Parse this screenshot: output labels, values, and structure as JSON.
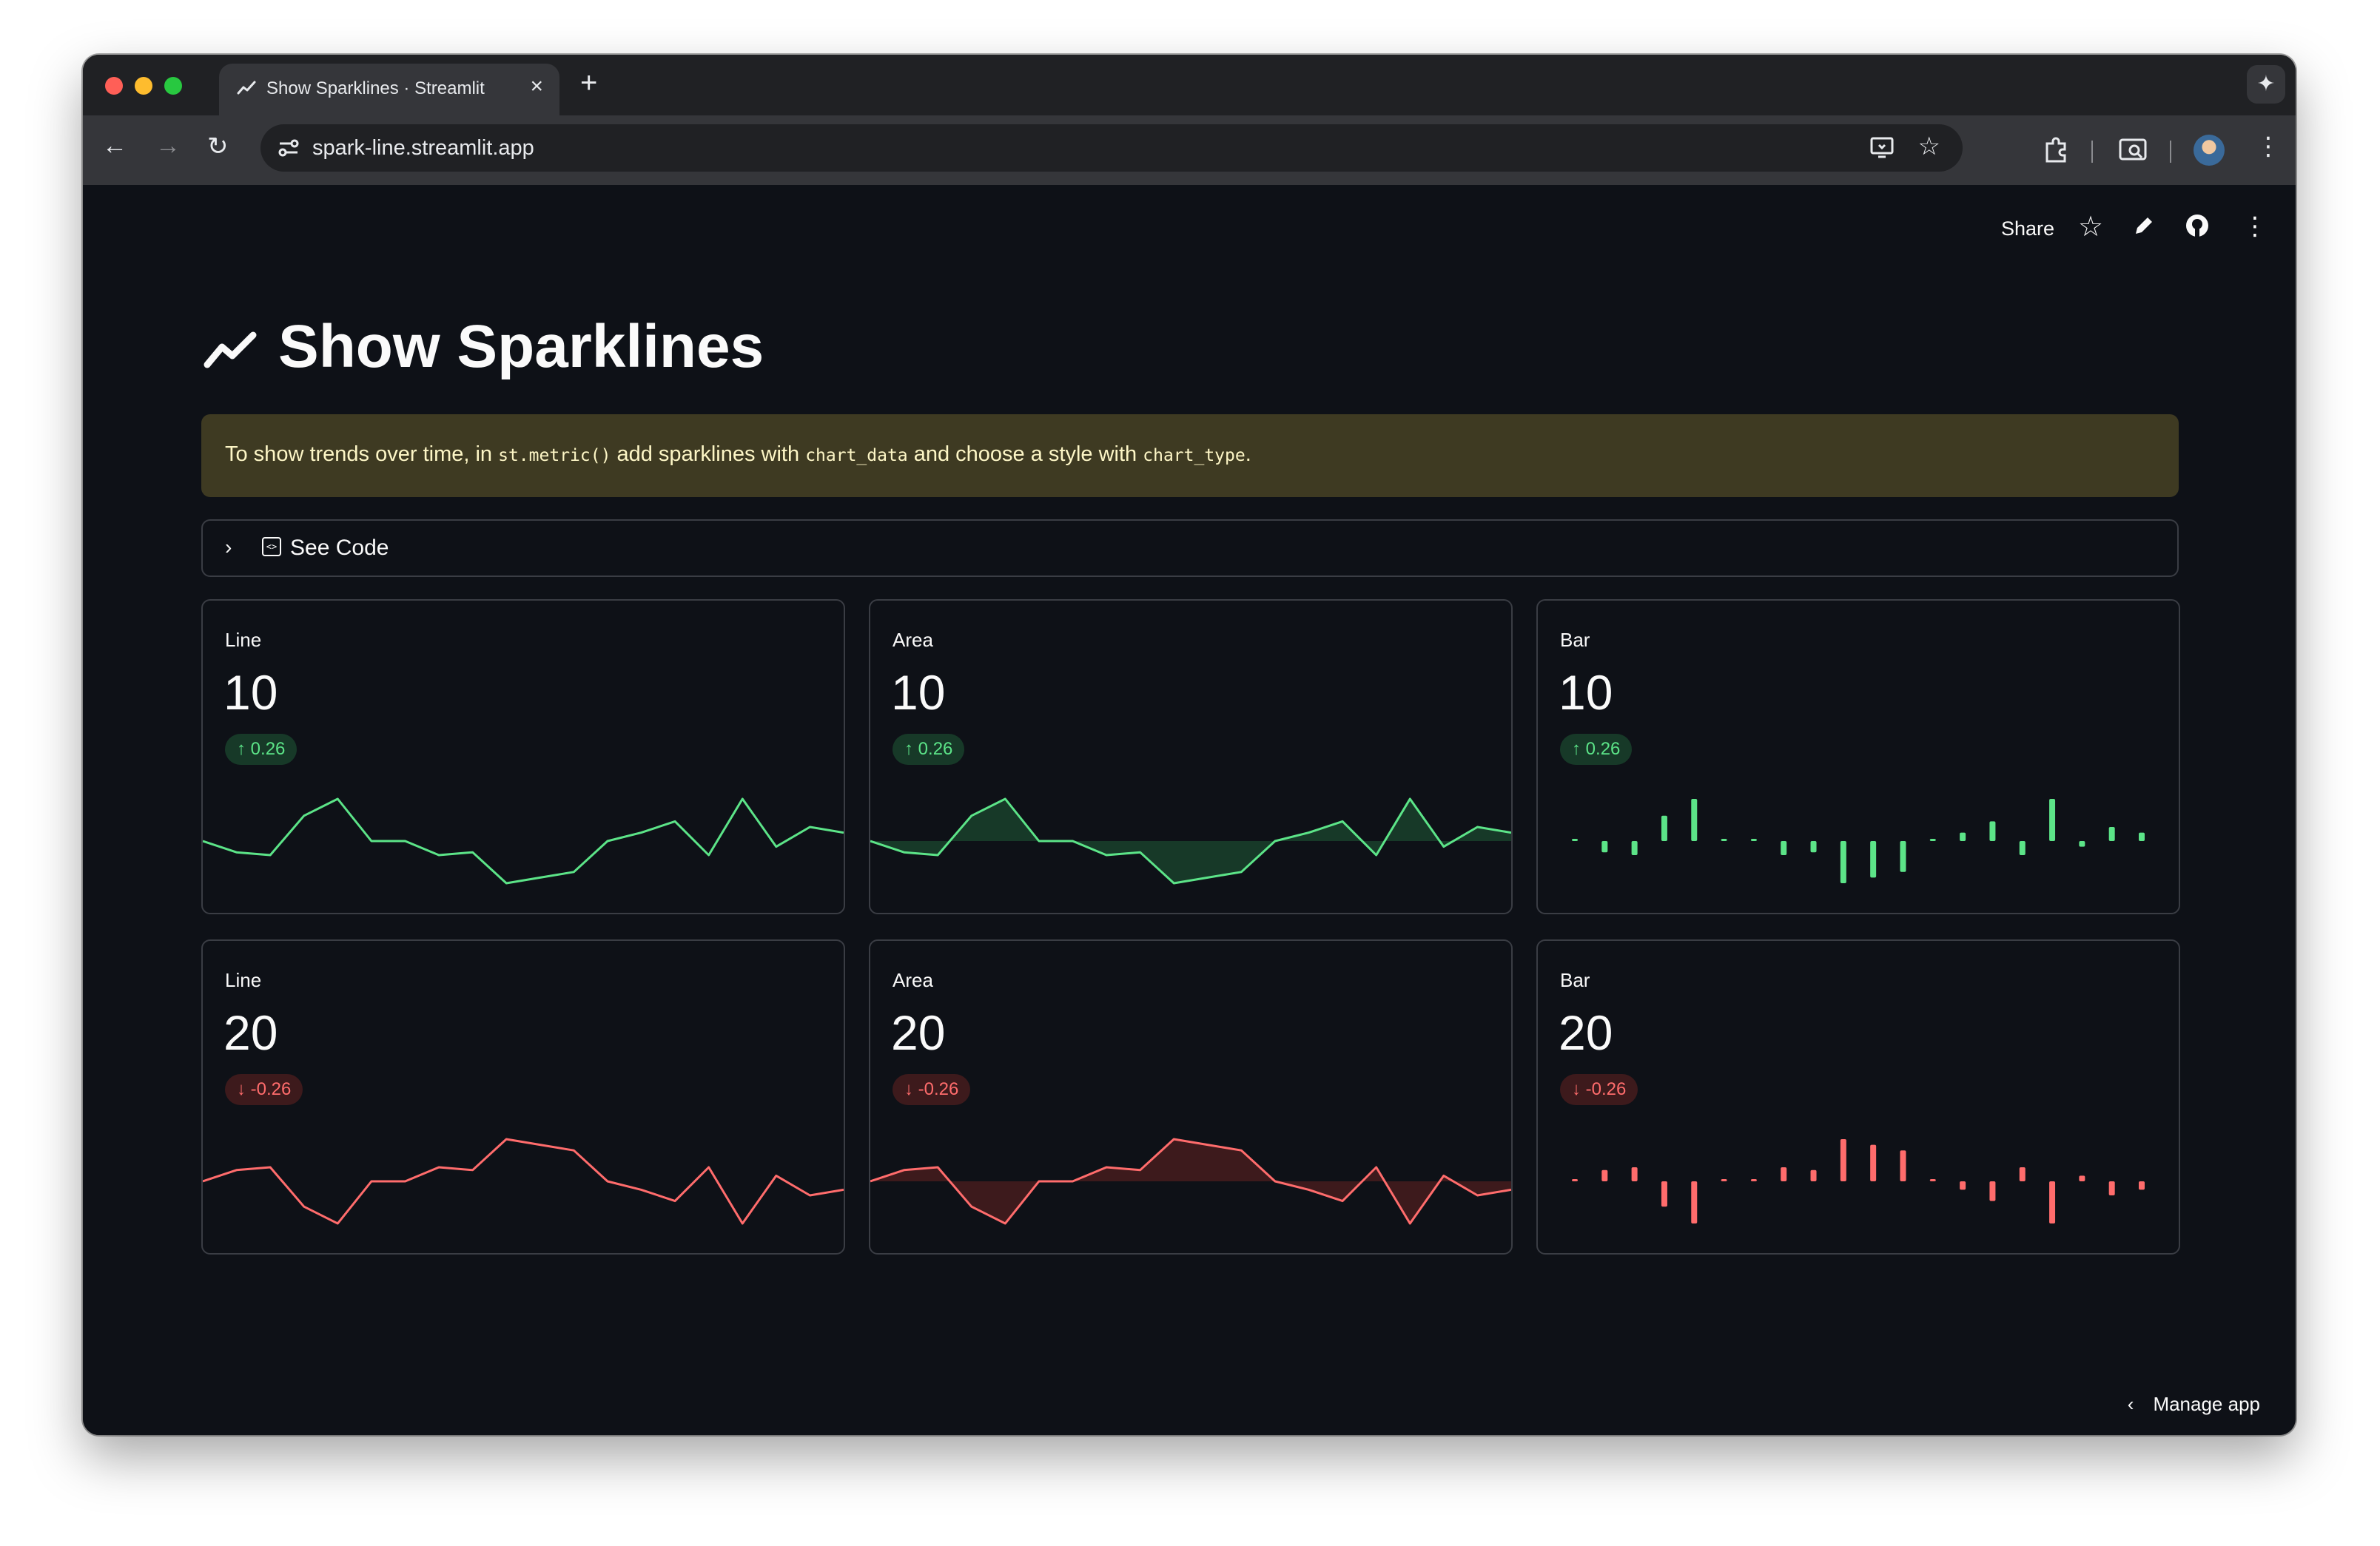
{
  "browser": {
    "tab_title": "Show Sparklines · Streamlit",
    "url": "spark-line.streamlit.app",
    "traffic_colors": [
      "#ff5f57",
      "#febc2e",
      "#28c840"
    ]
  },
  "header": {
    "share_label": "Share"
  },
  "page": {
    "title": "Show Sparklines",
    "alert": {
      "part1": "To show trends over time, in ",
      "code1": "st.metric()",
      "part2": " add sparklines with ",
      "code2": "chart_data",
      "part3": " and choose a style with ",
      "code3": "chart_type",
      "part4": "."
    },
    "expander_label": "See Code",
    "manage_label": "Manage app"
  },
  "colors": {
    "positive": "#5ce488",
    "negative": "#ff6c6c",
    "positive_fill": "#173928",
    "negative_fill": "#3d1a1c"
  },
  "metrics": [
    {
      "label": "Line",
      "value": "10",
      "delta": "0.26",
      "direction": "up",
      "chart_type": "line"
    },
    {
      "label": "Area",
      "value": "10",
      "delta": "0.26",
      "direction": "up",
      "chart_type": "area"
    },
    {
      "label": "Bar",
      "value": "10",
      "delta": "0.26",
      "direction": "up",
      "chart_type": "bar"
    },
    {
      "label": "Line",
      "value": "20",
      "delta": "-0.26",
      "direction": "down",
      "chart_type": "line"
    },
    {
      "label": "Area",
      "value": "20",
      "delta": "-0.26",
      "direction": "down",
      "chart_type": "area"
    },
    {
      "label": "Bar",
      "value": "20",
      "delta": "-0.26",
      "direction": "down",
      "chart_type": "bar"
    }
  ],
  "chart_data": [
    {
      "type": "line",
      "series": [
        {
          "values": [
            0,
            -0.4,
            -0.5,
            0.9,
            1.5,
            0,
            0,
            -0.5,
            -0.4,
            -1.5,
            -1.3,
            -1.1,
            0,
            0.3,
            0.7,
            -0.5,
            1.5,
            -0.2,
            0.5,
            0.3
          ]
        }
      ]
    },
    {
      "type": "area",
      "series": [
        {
          "values": [
            0,
            -0.4,
            -0.5,
            0.9,
            1.5,
            0,
            0,
            -0.5,
            -0.4,
            -1.5,
            -1.3,
            -1.1,
            0,
            0.3,
            0.7,
            -0.5,
            1.5,
            -0.2,
            0.5,
            0.3
          ]
        }
      ]
    },
    {
      "type": "bar",
      "series": [
        {
          "values": [
            0,
            -0.4,
            -0.5,
            0.9,
            1.5,
            0,
            0,
            -0.5,
            -0.4,
            -1.5,
            -1.3,
            -1.1,
            0,
            0.3,
            0.7,
            -0.5,
            1.5,
            -0.2,
            0.5,
            0.3
          ]
        }
      ]
    },
    {
      "type": "line",
      "series": [
        {
          "values": [
            0,
            0.4,
            0.5,
            -0.9,
            -1.5,
            0,
            0,
            0.5,
            0.4,
            1.5,
            1.3,
            1.1,
            0,
            -0.3,
            -0.7,
            0.5,
            -1.5,
            0.2,
            -0.5,
            -0.3
          ]
        }
      ]
    },
    {
      "type": "area",
      "series": [
        {
          "values": [
            0,
            0.4,
            0.5,
            -0.9,
            -1.5,
            0,
            0,
            0.5,
            0.4,
            1.5,
            1.3,
            1.1,
            0,
            -0.3,
            -0.7,
            0.5,
            -1.5,
            0.2,
            -0.5,
            -0.3
          ]
        }
      ]
    },
    {
      "type": "bar",
      "series": [
        {
          "values": [
            0,
            0.4,
            0.5,
            -0.9,
            -1.5,
            0,
            0,
            0.5,
            0.4,
            1.5,
            1.3,
            1.1,
            0,
            -0.3,
            -0.7,
            0.5,
            -1.5,
            0.2,
            -0.5,
            -0.3
          ]
        }
      ]
    }
  ]
}
